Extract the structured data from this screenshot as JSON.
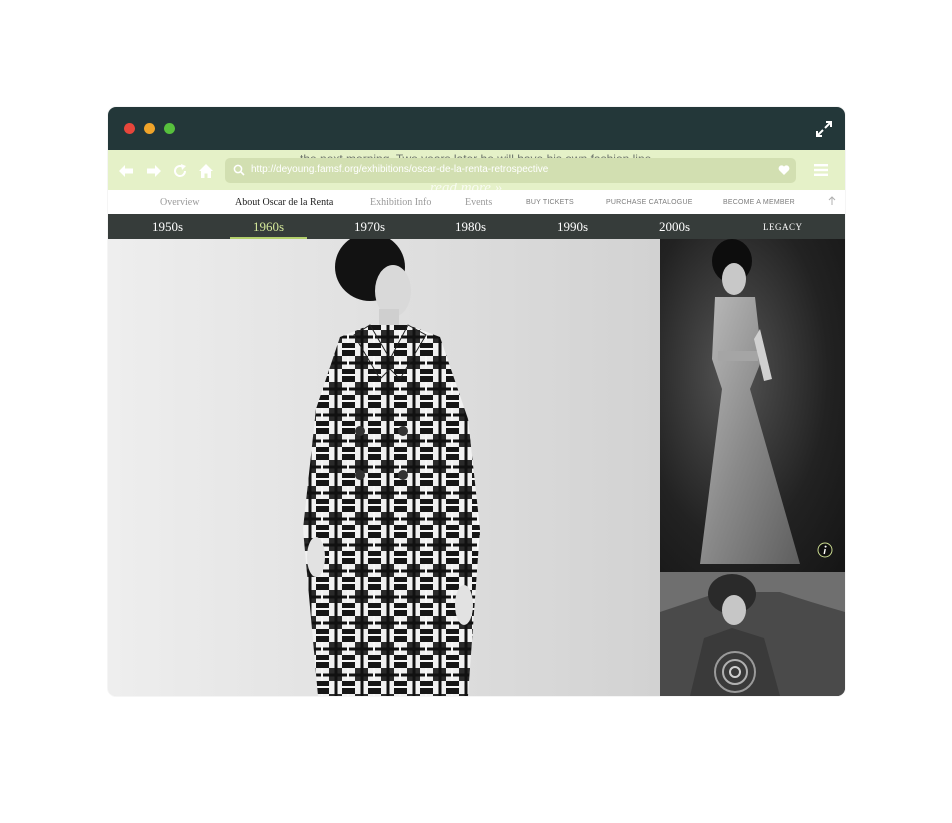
{
  "browser": {
    "url": "http://deyoung.famsf.org/exhibitions/oscar-de-la-renta-retrospective",
    "icons": [
      "close-dot",
      "minimize-dot",
      "zoom-dot",
      "fullscreen-icon",
      "back-icon",
      "forward-icon",
      "reload-icon",
      "home-icon",
      "search-icon",
      "heart-icon",
      "menu-icon"
    ],
    "colors": {
      "titlebar": "#233739",
      "toolbar": "#e5f1c8",
      "addressbar": "#d2dfb1"
    }
  },
  "page": {
    "ghost_text": "the next morning. Two years later he will have his own fashion line.",
    "ghost_read_more": "read more »",
    "subnav": [
      "Overview",
      "About Oscar de la Renta",
      "Exhibition Info",
      "Events",
      "BUY TICKETS",
      "PURCHASE CATALOGUE",
      "BECOME A MEMBER"
    ],
    "subnav_active": "About Oscar de la Renta",
    "decades": [
      "1950s",
      "1960s",
      "1970s",
      "1980s",
      "1990s",
      "2000s",
      "LEGACY"
    ],
    "decade_active": "1960s",
    "accent_color": "#b4d06c",
    "icons": [
      "scroll-top-icon",
      "info-icon"
    ]
  }
}
